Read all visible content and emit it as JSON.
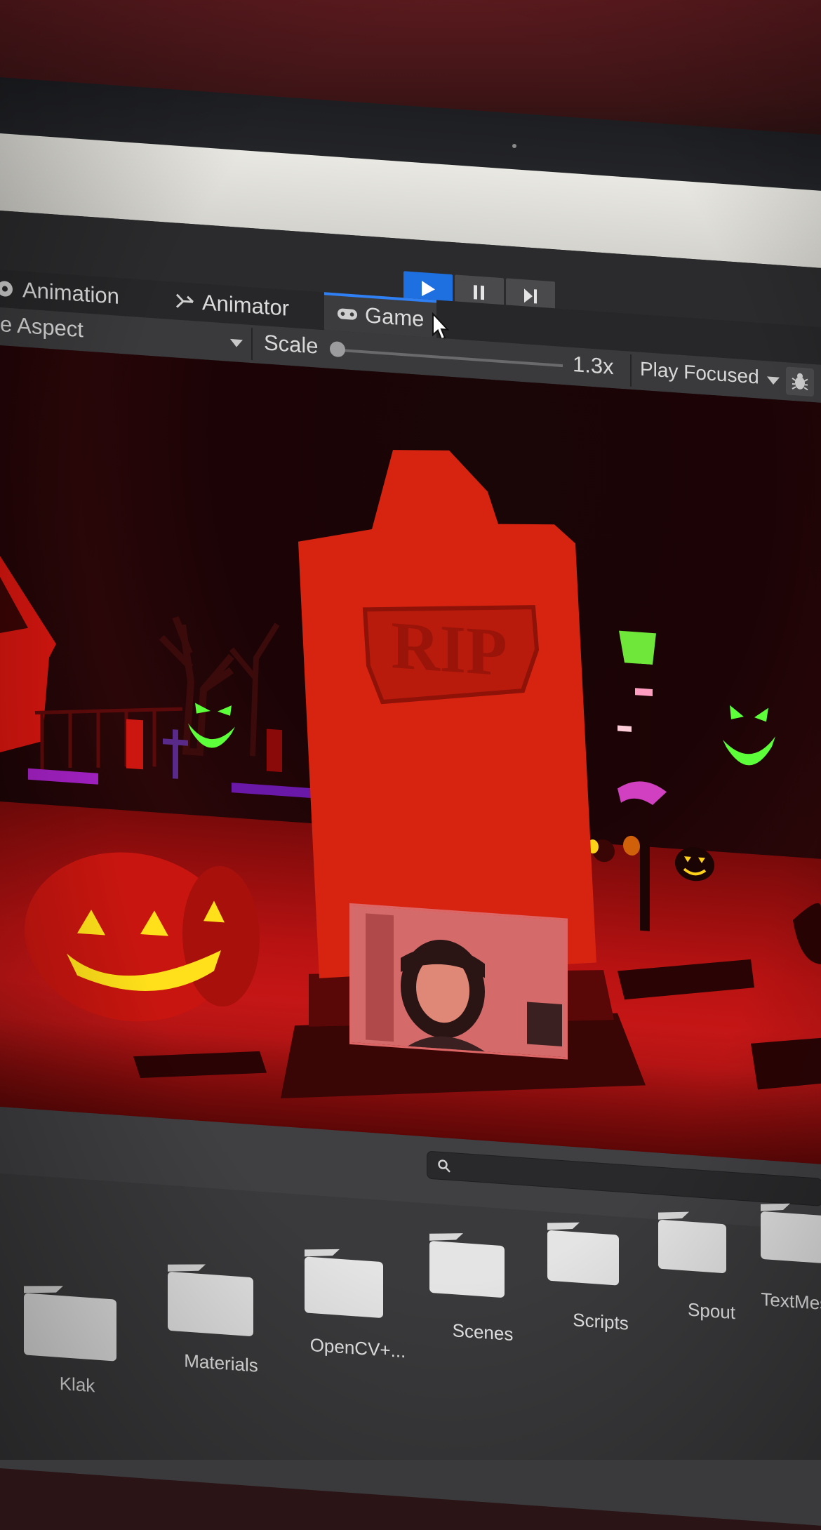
{
  "toolbar": {
    "play_state": "playing"
  },
  "tabs": [
    {
      "label": "Animation",
      "icon": "animation-icon",
      "active": false
    },
    {
      "label": "Animator",
      "icon": "animator-icon",
      "active": false
    },
    {
      "label": "Game",
      "icon": "gamepad-icon",
      "active": true
    }
  ],
  "game_controls": {
    "aspect_label": "e Aspect",
    "scale_label": "Scale",
    "scale_value": "1.3x",
    "play_mode": "Play Focused"
  },
  "game_view": {
    "tombstone_text": "RIP"
  },
  "search": {
    "placeholder": ""
  },
  "folders": [
    {
      "label": "Klak"
    },
    {
      "label": "Materials"
    },
    {
      "label": "OpenCV+..."
    },
    {
      "label": "Scenes"
    },
    {
      "label": "Scripts"
    },
    {
      "label": "Spout"
    },
    {
      "label": "TextMesh"
    }
  ],
  "colors": {
    "accent": "#2f7ff5",
    "play_active": "#1e6fe0",
    "scene_red": "#cf1818",
    "glow_green": "#5cff3a",
    "pumpkin_yellow": "#ffd21a"
  }
}
